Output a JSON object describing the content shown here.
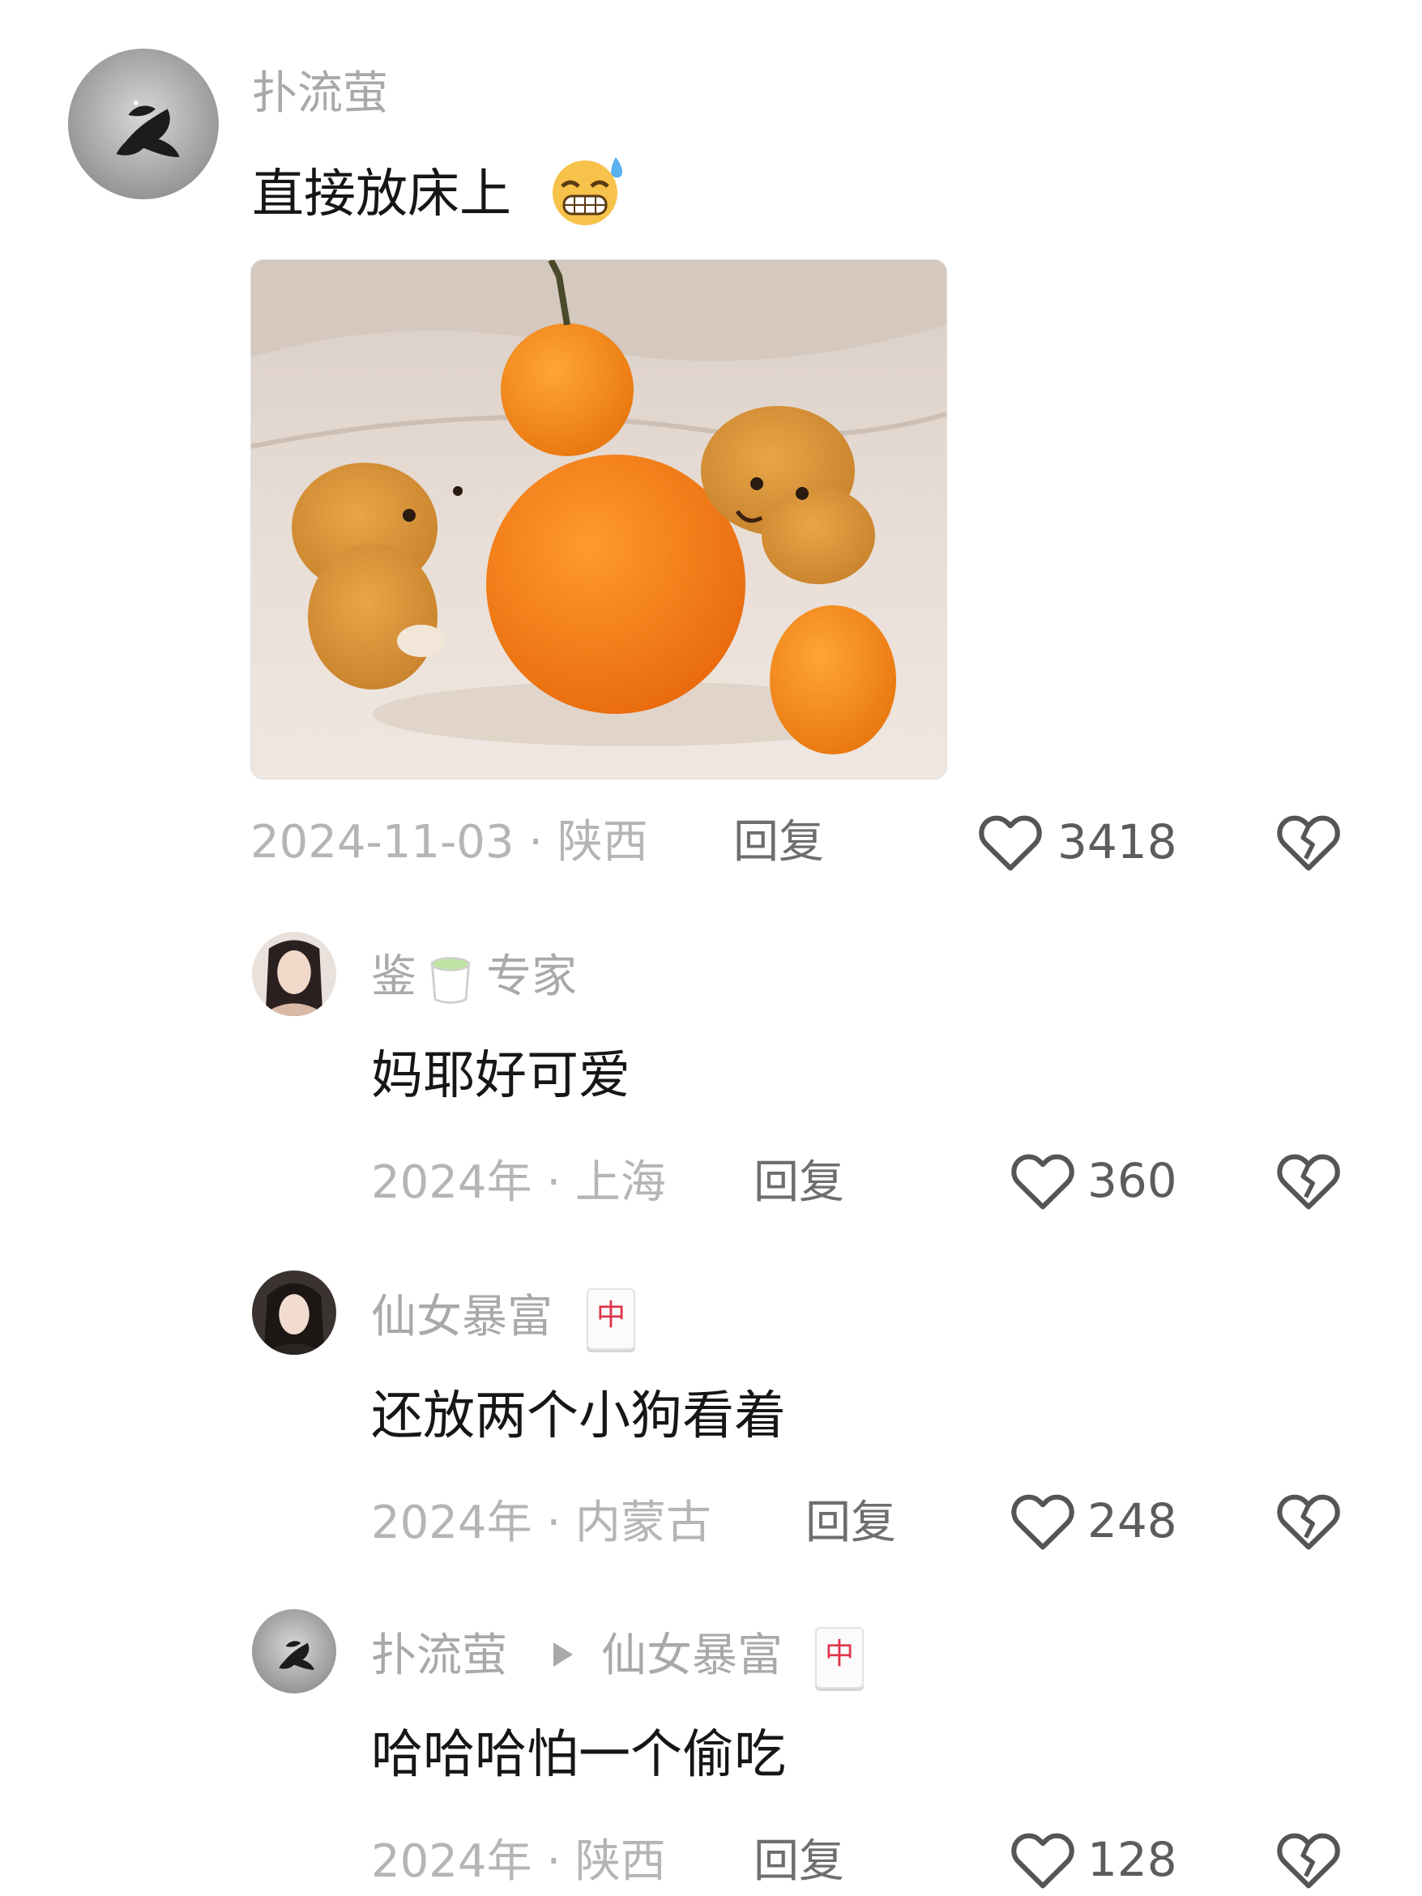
{
  "comments": [
    {
      "username": "扑流萤",
      "content": "直接放床上",
      "emoji_icon": "grimacing-sweat-emoji-icon",
      "date_location": "2024-11-03 · 陕西",
      "reply_label": "回复",
      "like_count": "3418"
    },
    {
      "username_part1": "鉴",
      "username_icon": "teacup-emoji-icon",
      "username_part2": "专家",
      "content": "妈耶好可爱",
      "date_location": "2024年 · 上海",
      "reply_label": "回复",
      "like_count": "360"
    },
    {
      "username": "仙女暴富",
      "username_icon": "mahjong-red-dragon-icon",
      "badge_char": "中",
      "content": "还放两个小狗看着",
      "date_location": "2024年 · 内蒙古",
      "reply_label": "回复",
      "like_count": "248"
    },
    {
      "username": "扑流萤",
      "reply_to_icon": "triangle-right-icon",
      "reply_to": "仙女暴富",
      "badge_char": "中",
      "content": "哈哈哈怕一个偷吃",
      "date_location": "2024年 · 陕西",
      "reply_label": "回复",
      "like_count": "128"
    }
  ],
  "colors": {
    "username": "#a9a9a9",
    "content": "#161616",
    "meta": "#b5b5b5",
    "orange": "#f08a1c",
    "badge_red": "#e0334a"
  }
}
